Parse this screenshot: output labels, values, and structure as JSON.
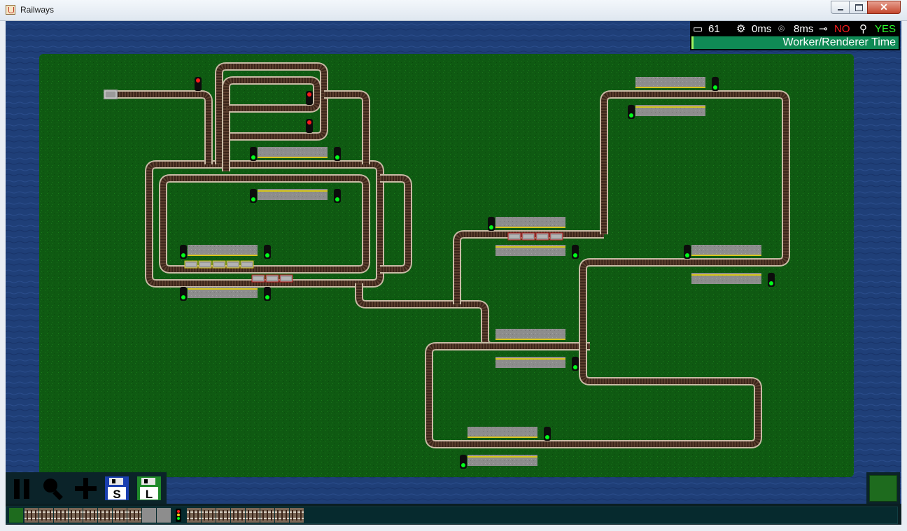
{
  "window": {
    "title": "Railways",
    "close_glyph": "✕"
  },
  "stats": {
    "frames": "61",
    "frames_icon": "windows-icon",
    "worker_time": "0ms",
    "worker_icon": "gear-icon",
    "render_time": "8ms",
    "render_icon": "satellite-dish-icon",
    "connected_icon": "plug-icon",
    "connected": "NO",
    "zoom_icon": "magnifier-icon",
    "visible": "YES",
    "bar_label": "Worker/Renderer Time",
    "colors": {
      "no": "#ff1e1e",
      "yes": "#2eff2e",
      "bar": "#0f8a55"
    }
  },
  "toolbar": {
    "buttons": [
      {
        "name": "pause-button",
        "icon": "pause-icon"
      },
      {
        "name": "zoom-button",
        "icon": "magnifier-icon"
      },
      {
        "name": "add-button",
        "icon": "plus-icon"
      },
      {
        "name": "save-button",
        "icon": "floppy-disk-icon",
        "letter": "S"
      },
      {
        "name": "load-button",
        "icon": "floppy-disk-icon",
        "letter": "L"
      }
    ]
  },
  "palette": {
    "items": [
      "grass-tile",
      "track-straight",
      "track-straight-vertical",
      "track-curve",
      "track-switch",
      "track-curve-alt",
      "track-switch-alt",
      "track-buffer",
      "track-end",
      "platform-tile",
      "platform-corner",
      "signal-tile",
      "track-horizontal-1",
      "track-horizontal-2",
      "track-horizontal-3",
      "track-horizontal-4",
      "track-horizontal-5",
      "track-horizontal-6",
      "track-horizontal-7",
      "track-horizontal-8"
    ]
  },
  "colors": {
    "water": "#1f3f78",
    "grass": "#0f5a12",
    "rail": "#a99a86",
    "sleeper": "#4a2f22",
    "platform": "#8f8f8f",
    "signal_green": "#00ff1a",
    "signal_red": "#ff1a1a",
    "wagon": "#9b9b9b",
    "wagon_border": "#c01f1f"
  }
}
